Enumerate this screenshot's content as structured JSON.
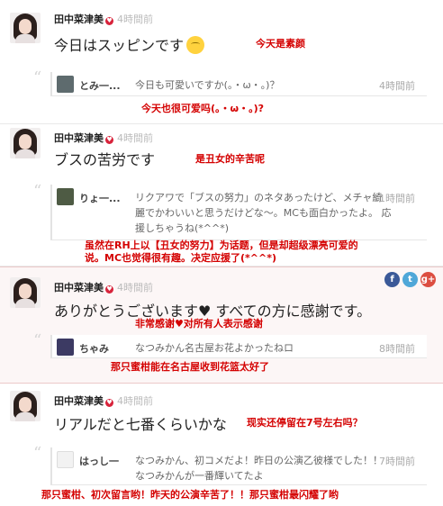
{
  "posts": [
    {
      "author": "田中菜津美",
      "verified_icon": "verified-heart-icon",
      "time": "4時間前",
      "message": "今日はスッピンです",
      "translation": "今天是素颜",
      "comment": {
        "name": "とみ一...",
        "text": "今日も可愛いですか(。・ω・。)？",
        "time": "4時間前",
        "translation": "今天也很可爱吗(。・ω・。)?"
      }
    },
    {
      "author": "田中菜津美",
      "verified_icon": "verified-heart-icon",
      "time": "4時間前",
      "message": "ブスの苦労です",
      "translation": "是丑女的辛苦呢",
      "comment": {
        "name": "りょ一...",
        "text": "リクアワで「ブスの努力」のネタあったけど、メチャ綺麗でかわいいと思うだけどな〜。MCも面白かったよ。 応援しちゃうね(*^^*)",
        "time": "11時間前",
        "translation": "虽然在RH上以【丑女的努力】为话题，但是却超级漂亮可爱的说。MC也觉得很有趣。决定应援了(*^^*)"
      }
    },
    {
      "author": "田中菜津美",
      "verified_icon": "verified-heart-icon",
      "time": "4時間前",
      "message": "ありがとうございます♥ すべての方に感謝です。",
      "translation": "非常感谢♥对所有人表示感谢",
      "social": [
        "f",
        "t",
        "g+"
      ],
      "comment": {
        "name": "ちゃみ",
        "text": "なつみかん名古屋お花よかったねロ",
        "time": "8時間前",
        "translation": "那只蜜柑能在名古屋收到花篮太好了"
      }
    },
    {
      "author": "田中菜津美",
      "verified_icon": "verified-heart-icon",
      "time": "4時間前",
      "message": "リアルだと七番くらいかな",
      "translation": "现实还停留在7号左右吗？",
      "comment": {
        "name": "はっし一",
        "text": "なつみかん、初コメだよ！昨日の公演乙彼様でした！！なつみかんが一番輝いてたよ",
        "time": "7時間前",
        "translation": "那只蜜柑、初次留言哟！昨天的公演辛苦了！！那只蜜柑最闪耀了哟"
      }
    }
  ],
  "colors": {
    "translation": "#d40000",
    "highlight_bg": "#fcf6f6",
    "verified": "#d8233b",
    "facebook": "#3b5998",
    "twitter": "#4fa7d8",
    "googleplus": "#dc4e41"
  }
}
